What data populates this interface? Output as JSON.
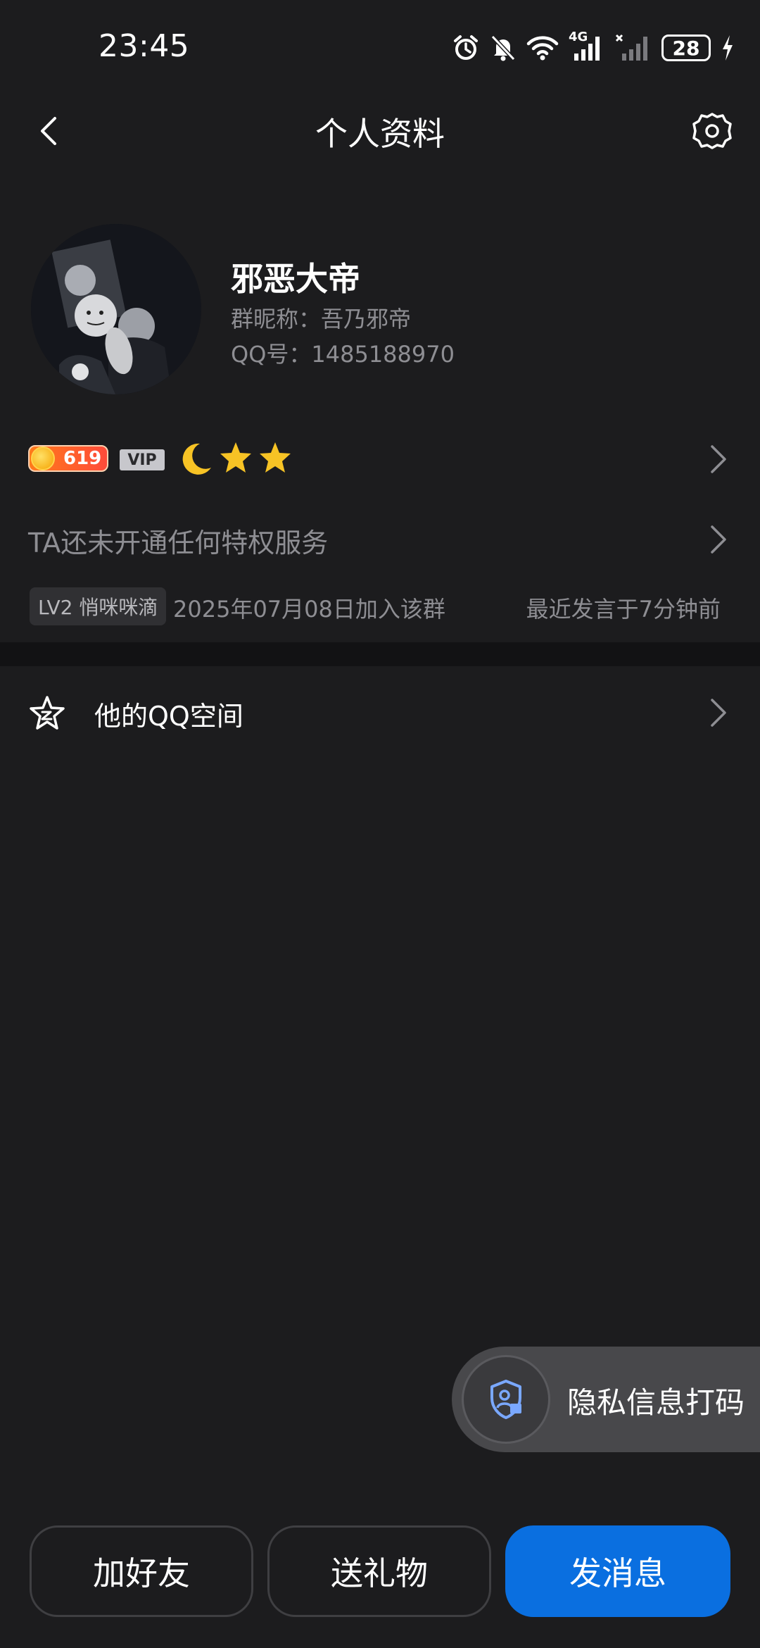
{
  "status_bar": {
    "time": "23:45",
    "network_label": "4G",
    "battery": "28",
    "icons": [
      "alarm-icon",
      "mute-bell-icon",
      "wifi-icon",
      "signal-4g-icon",
      "signal-no-sim-icon",
      "battery-icon",
      "charging-icon"
    ]
  },
  "nav": {
    "title": "个人资料",
    "back_icon": "chevron-left-icon",
    "settings_icon": "gear-icon"
  },
  "profile": {
    "name": "邪恶大帝",
    "group_nickname": "群昵称：吾乃邪帝",
    "qq_number": "QQ号：1485188970"
  },
  "badges": {
    "level_number": "619",
    "vip_label": "VIP",
    "rank_icons": [
      "moon-icon",
      "star-icon",
      "star-icon"
    ]
  },
  "privilege": {
    "text": "TA还未开通任何特权服务"
  },
  "group_info": {
    "level_tag": "LV2 悄咪咪滴",
    "join_date": "2025年07月08日加入该群",
    "last_speak": "最近发言于7分钟前"
  },
  "qzone": {
    "label": "他的QQ空间"
  },
  "privacy_toggle": {
    "label": "隐私信息打码"
  },
  "actions": {
    "add_friend": "加好友",
    "send_gift": "送礼物",
    "send_message": "发消息"
  },
  "colors": {
    "background": "#1c1c1e",
    "primary_button": "#0a6fe0",
    "secondary_text": "#8e8e93",
    "star": "#f7c325"
  }
}
